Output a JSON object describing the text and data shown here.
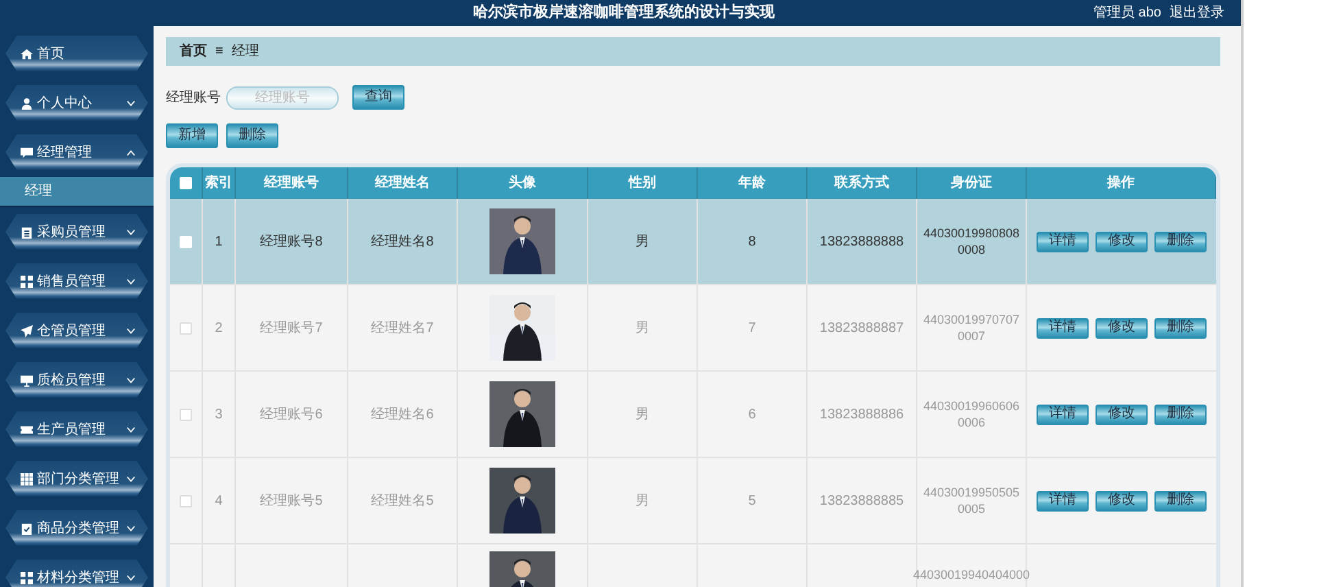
{
  "header": {
    "title": "哈尔滨市极岸速溶咖啡管理系统的设计与实现",
    "user": "管理员 abo",
    "logout": "退出登录"
  },
  "sidebar": {
    "items": [
      {
        "label": "首页",
        "kind": "link"
      },
      {
        "label": "个人中心",
        "kind": "group",
        "expanded": false
      },
      {
        "label": "经理管理",
        "kind": "group",
        "expanded": true,
        "children": [
          {
            "label": "经理",
            "selected": true
          }
        ]
      },
      {
        "label": "采购员管理",
        "kind": "group",
        "expanded": false
      },
      {
        "label": "销售员管理",
        "kind": "group",
        "expanded": false
      },
      {
        "label": "仓管员管理",
        "kind": "group",
        "expanded": false
      },
      {
        "label": "质检员管理",
        "kind": "group",
        "expanded": false
      },
      {
        "label": "生产员管理",
        "kind": "group",
        "expanded": false
      },
      {
        "label": "部门分类管理",
        "kind": "group",
        "expanded": false
      },
      {
        "label": "商品分类管理",
        "kind": "group",
        "expanded": false
      },
      {
        "label": "材料分类管理",
        "kind": "group",
        "expanded": false
      }
    ]
  },
  "breadcrumb": [
    "首页",
    "≡",
    "经理"
  ],
  "search": {
    "label": "经理账号",
    "placeholder": "经理账号",
    "button": "查询"
  },
  "toolbar": [
    "新增",
    "删除"
  ],
  "table": {
    "select_all_checked": false,
    "columns": [
      "索引",
      "经理账号",
      "经理姓名",
      "头像",
      "性别",
      "年龄",
      "联系方式",
      "身份证",
      "操作"
    ],
    "rows": [
      {
        "selected": true,
        "checked": false,
        "index": "1",
        "account": "经理账号8",
        "name": "经理姓名8",
        "gender": "男",
        "age": "8",
        "phone": "13823888888",
        "id_card": "440300199808080008",
        "actions": [
          "详情",
          "修改",
          "删除"
        ]
      },
      {
        "selected": false,
        "checked": false,
        "index": "2",
        "account": "经理账号7",
        "name": "经理姓名7",
        "gender": "男",
        "age": "7",
        "phone": "13823888887",
        "id_card": "440300199707070007",
        "actions": [
          "详情",
          "修改",
          "删除"
        ]
      },
      {
        "selected": false,
        "checked": false,
        "index": "3",
        "account": "经理账号6",
        "name": "经理姓名6",
        "gender": "男",
        "age": "6",
        "phone": "13823888886",
        "id_card": "440300199606060006",
        "actions": [
          "详情",
          "修改",
          "删除"
        ]
      },
      {
        "selected": false,
        "checked": false,
        "index": "4",
        "account": "经理账号5",
        "name": "经理姓名5",
        "gender": "男",
        "age": "5",
        "phone": "13823888885",
        "id_card": "440300199505050005",
        "actions": [
          "详情",
          "修改",
          "删除"
        ]
      }
    ],
    "partial_row": {
      "id_card": "44030019940404000"
    }
  }
}
